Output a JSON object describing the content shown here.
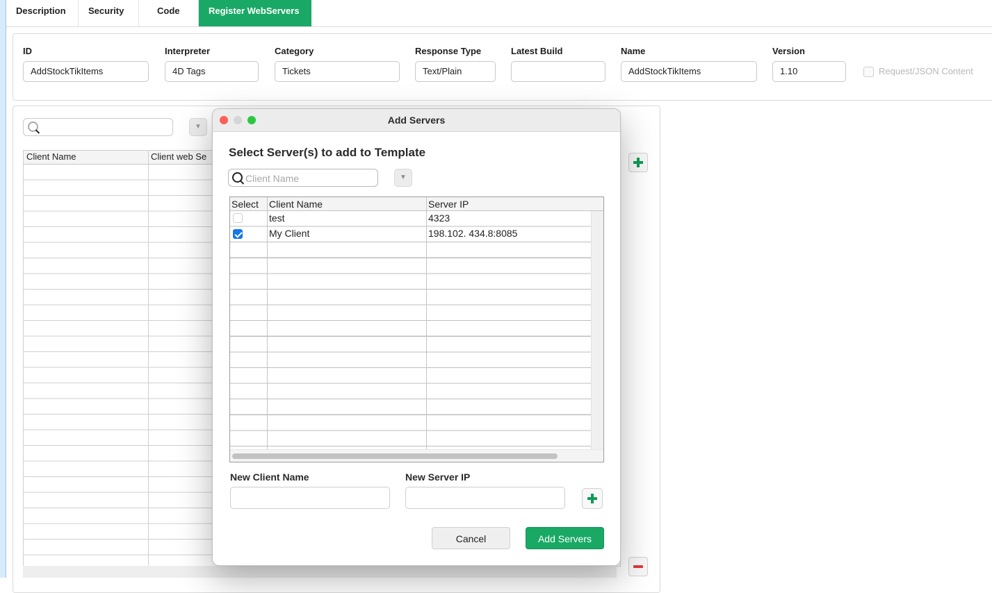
{
  "tabs": [
    {
      "label": "Description"
    },
    {
      "label": "Security"
    },
    {
      "label": "Code"
    },
    {
      "label": "Register WebServers",
      "active": true
    }
  ],
  "info": {
    "id": {
      "label": "ID",
      "value": "AddStockTikItems"
    },
    "interpreter": {
      "label": "Interpreter",
      "value": "4D Tags"
    },
    "category": {
      "label": "Category",
      "value": "Tickets"
    },
    "response_type": {
      "label": "Response Type",
      "value": "Text/Plain"
    },
    "latest_build": {
      "label": "Latest Build",
      "value": ""
    },
    "name": {
      "label": "Name",
      "value": "AddStockTikItems"
    },
    "version": {
      "label": "Version",
      "value": "1.10"
    },
    "request_json": {
      "label": "Request/JSON Content",
      "checked": false
    }
  },
  "background_list": {
    "columns": [
      "Client Name",
      "Client web Se"
    ]
  },
  "dialog": {
    "title": "Add Servers",
    "heading": "Select Server(s) to add to Template",
    "search": {
      "placeholder": "Client Name",
      "value": ""
    },
    "table": {
      "columns": [
        "Select",
        "Client Name",
        "Server IP"
      ],
      "rows": [
        {
          "selected": false,
          "client_name": "test",
          "server_ip": "4323"
        },
        {
          "selected": true,
          "client_name": "My Client",
          "server_ip": "198.102. 434.8:8085"
        }
      ]
    },
    "new_client_label": "New Client Name",
    "new_server_label": "New Server IP",
    "new_client_value": "",
    "new_server_value": "",
    "cancel_label": "Cancel",
    "add_label": "Add Servers"
  },
  "colors": {
    "accent_green": "#1aa866",
    "checkbox_blue": "#1677e8",
    "remove_red": "#e03a3a"
  },
  "icons": {
    "search": "search-icon",
    "filter": "filter-dropdown-icon",
    "add": "plus-icon",
    "remove": "minus-icon"
  }
}
